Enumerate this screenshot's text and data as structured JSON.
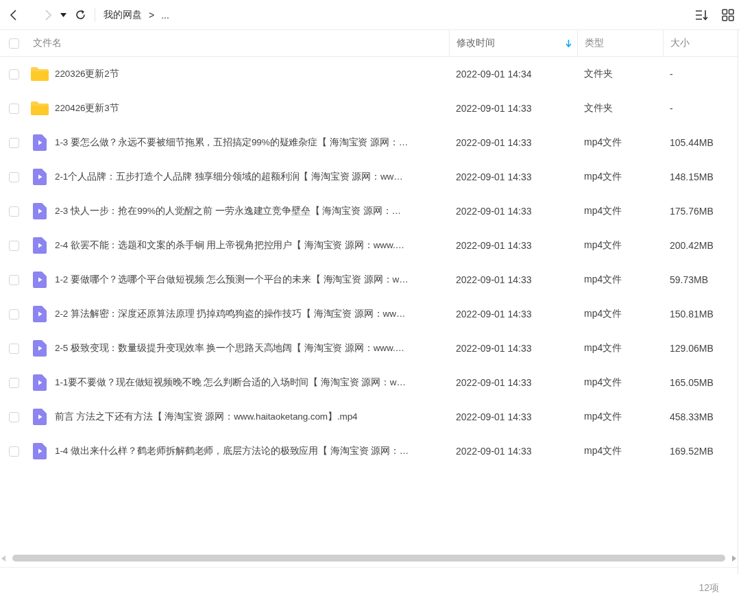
{
  "toolbar": {
    "forward_disabled": true,
    "breadcrumb": [
      {
        "label": "我的网盘"
      },
      {
        "label": ">"
      },
      {
        "label": "..."
      }
    ]
  },
  "table": {
    "select_all": {
      "checked": false
    },
    "columns": [
      {
        "label": "文件名",
        "sorted": false
      },
      {
        "label": "修改时间",
        "sorted": true
      },
      {
        "label": "类型",
        "sorted": false
      },
      {
        "label": "大小",
        "sorted": false
      }
    ],
    "rows": [
      {
        "kind": "folder",
        "checked": false,
        "name": "220326更新2节",
        "modified": "2022-09-01 14:34",
        "type": "文件夹",
        "size": "-"
      },
      {
        "kind": "folder",
        "checked": false,
        "name": "220426更新3节",
        "modified": "2022-09-01 14:33",
        "type": "文件夹",
        "size": "-"
      },
      {
        "kind": "video",
        "checked": false,
        "name": "1-3 要怎么做？永远不要被细节拖累，五招搞定99%的疑难杂症【 海淘宝资 源网：…",
        "modified": "2022-09-01 14:33",
        "type": "mp4文件",
        "size": "105.44MB"
      },
      {
        "kind": "video",
        "checked": false,
        "name": "2-1个人品牌：五步打造个人品牌 独享细分领域的超额利润【 海淘宝资 源网：ww…",
        "modified": "2022-09-01 14:33",
        "type": "mp4文件",
        "size": "148.15MB"
      },
      {
        "kind": "video",
        "checked": false,
        "name": "2-3 快人一步：抢在99%的人觉醒之前 一劳永逸建立竞争壁垒【 海淘宝资 源网：…",
        "modified": "2022-09-01 14:33",
        "type": "mp4文件",
        "size": "175.76MB"
      },
      {
        "kind": "video",
        "checked": false,
        "name": "2-4 欲罢不能：选题和文案的杀手锏 用上帝视角把控用户【 海淘宝资 源网：www.…",
        "modified": "2022-09-01 14:33",
        "type": "mp4文件",
        "size": "200.42MB"
      },
      {
        "kind": "video",
        "checked": false,
        "name": "1-2 要做哪个？选哪个平台做短视频 怎么预测一个平台的未来【 海淘宝资 源网：w…",
        "modified": "2022-09-01 14:33",
        "type": "mp4文件",
        "size": "59.73MB"
      },
      {
        "kind": "video",
        "checked": false,
        "name": "2-2 算法解密：深度还原算法原理 扔掉鸡鸣狗盗的操作技巧【 海淘宝资 源网：ww…",
        "modified": "2022-09-01 14:33",
        "type": "mp4文件",
        "size": "150.81MB"
      },
      {
        "kind": "video",
        "checked": false,
        "name": "2-5 极致变现：数量级提升变现效率 换一个思路天高地阔【 海淘宝资 源网：www.…",
        "modified": "2022-09-01 14:33",
        "type": "mp4文件",
        "size": "129.06MB"
      },
      {
        "kind": "video",
        "checked": false,
        "name": "1-1要不要做？现在做短视频晚不晚 怎么判断合适的入场时间【 海淘宝资 源网：w…",
        "modified": "2022-09-01 14:33",
        "type": "mp4文件",
        "size": "165.05MB"
      },
      {
        "kind": "video",
        "checked": false,
        "name": "前言  方法之下还有方法【 海淘宝资 源网：www.haitaoketang.com】.mp4",
        "modified": "2022-09-01 14:33",
        "type": "mp4文件",
        "size": "458.33MB"
      },
      {
        "kind": "video",
        "checked": false,
        "name": "1-4 做出来什么样？鹤老师拆解鹤老师，底层方法论的极致应用【 海淘宝资 源网：…",
        "modified": "2022-09-01 14:33",
        "type": "mp4文件",
        "size": "169.52MB"
      }
    ]
  },
  "status_bar": {
    "count": "12项"
  }
}
